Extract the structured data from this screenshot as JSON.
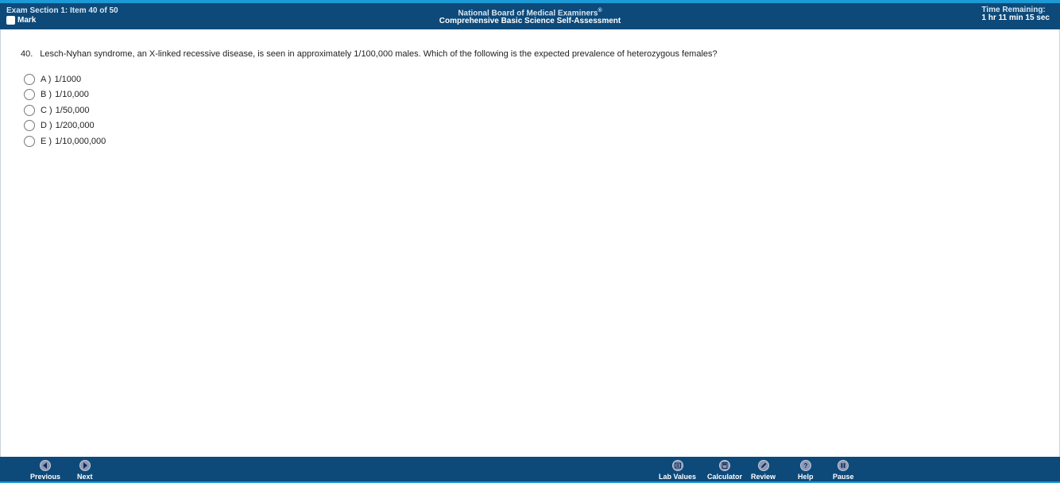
{
  "header": {
    "section_status": "Exam Section 1: Item 40 of 50",
    "mark_label": "Mark",
    "org_name": "National Board of Medical Examiners",
    "org_reg": "®",
    "exam_name": "Comprehensive Basic Science Self-Assessment",
    "time_label": "Time Remaining:",
    "time_value": "1 hr 11 min 15 sec"
  },
  "question": {
    "number": "40.",
    "text": "Lesch-Nyhan syndrome, an X-linked recessive disease, is seen in approximately 1/100,000 males. Which of the following is the expected prevalence of heterozygous females?",
    "options": [
      {
        "letter": "A )",
        "text": "1/1000"
      },
      {
        "letter": "B )",
        "text": "1/10,000"
      },
      {
        "letter": "C )",
        "text": "1/50,000"
      },
      {
        "letter": "D )",
        "text": "1/200,000"
      },
      {
        "letter": "E )",
        "text": "1/10,000,000"
      }
    ]
  },
  "footer": {
    "previous_label": "Previous",
    "next_label": "Next",
    "lab_values_label": "Lab Values",
    "calculator_label": "Calculator",
    "review_label": "Review",
    "help_label": "Help",
    "pause_label": "Pause"
  },
  "colors": {
    "bar_bg": "#0d4a7a",
    "bar_accent": "#1b9ad6",
    "icon_bg": "#8d98b4"
  }
}
